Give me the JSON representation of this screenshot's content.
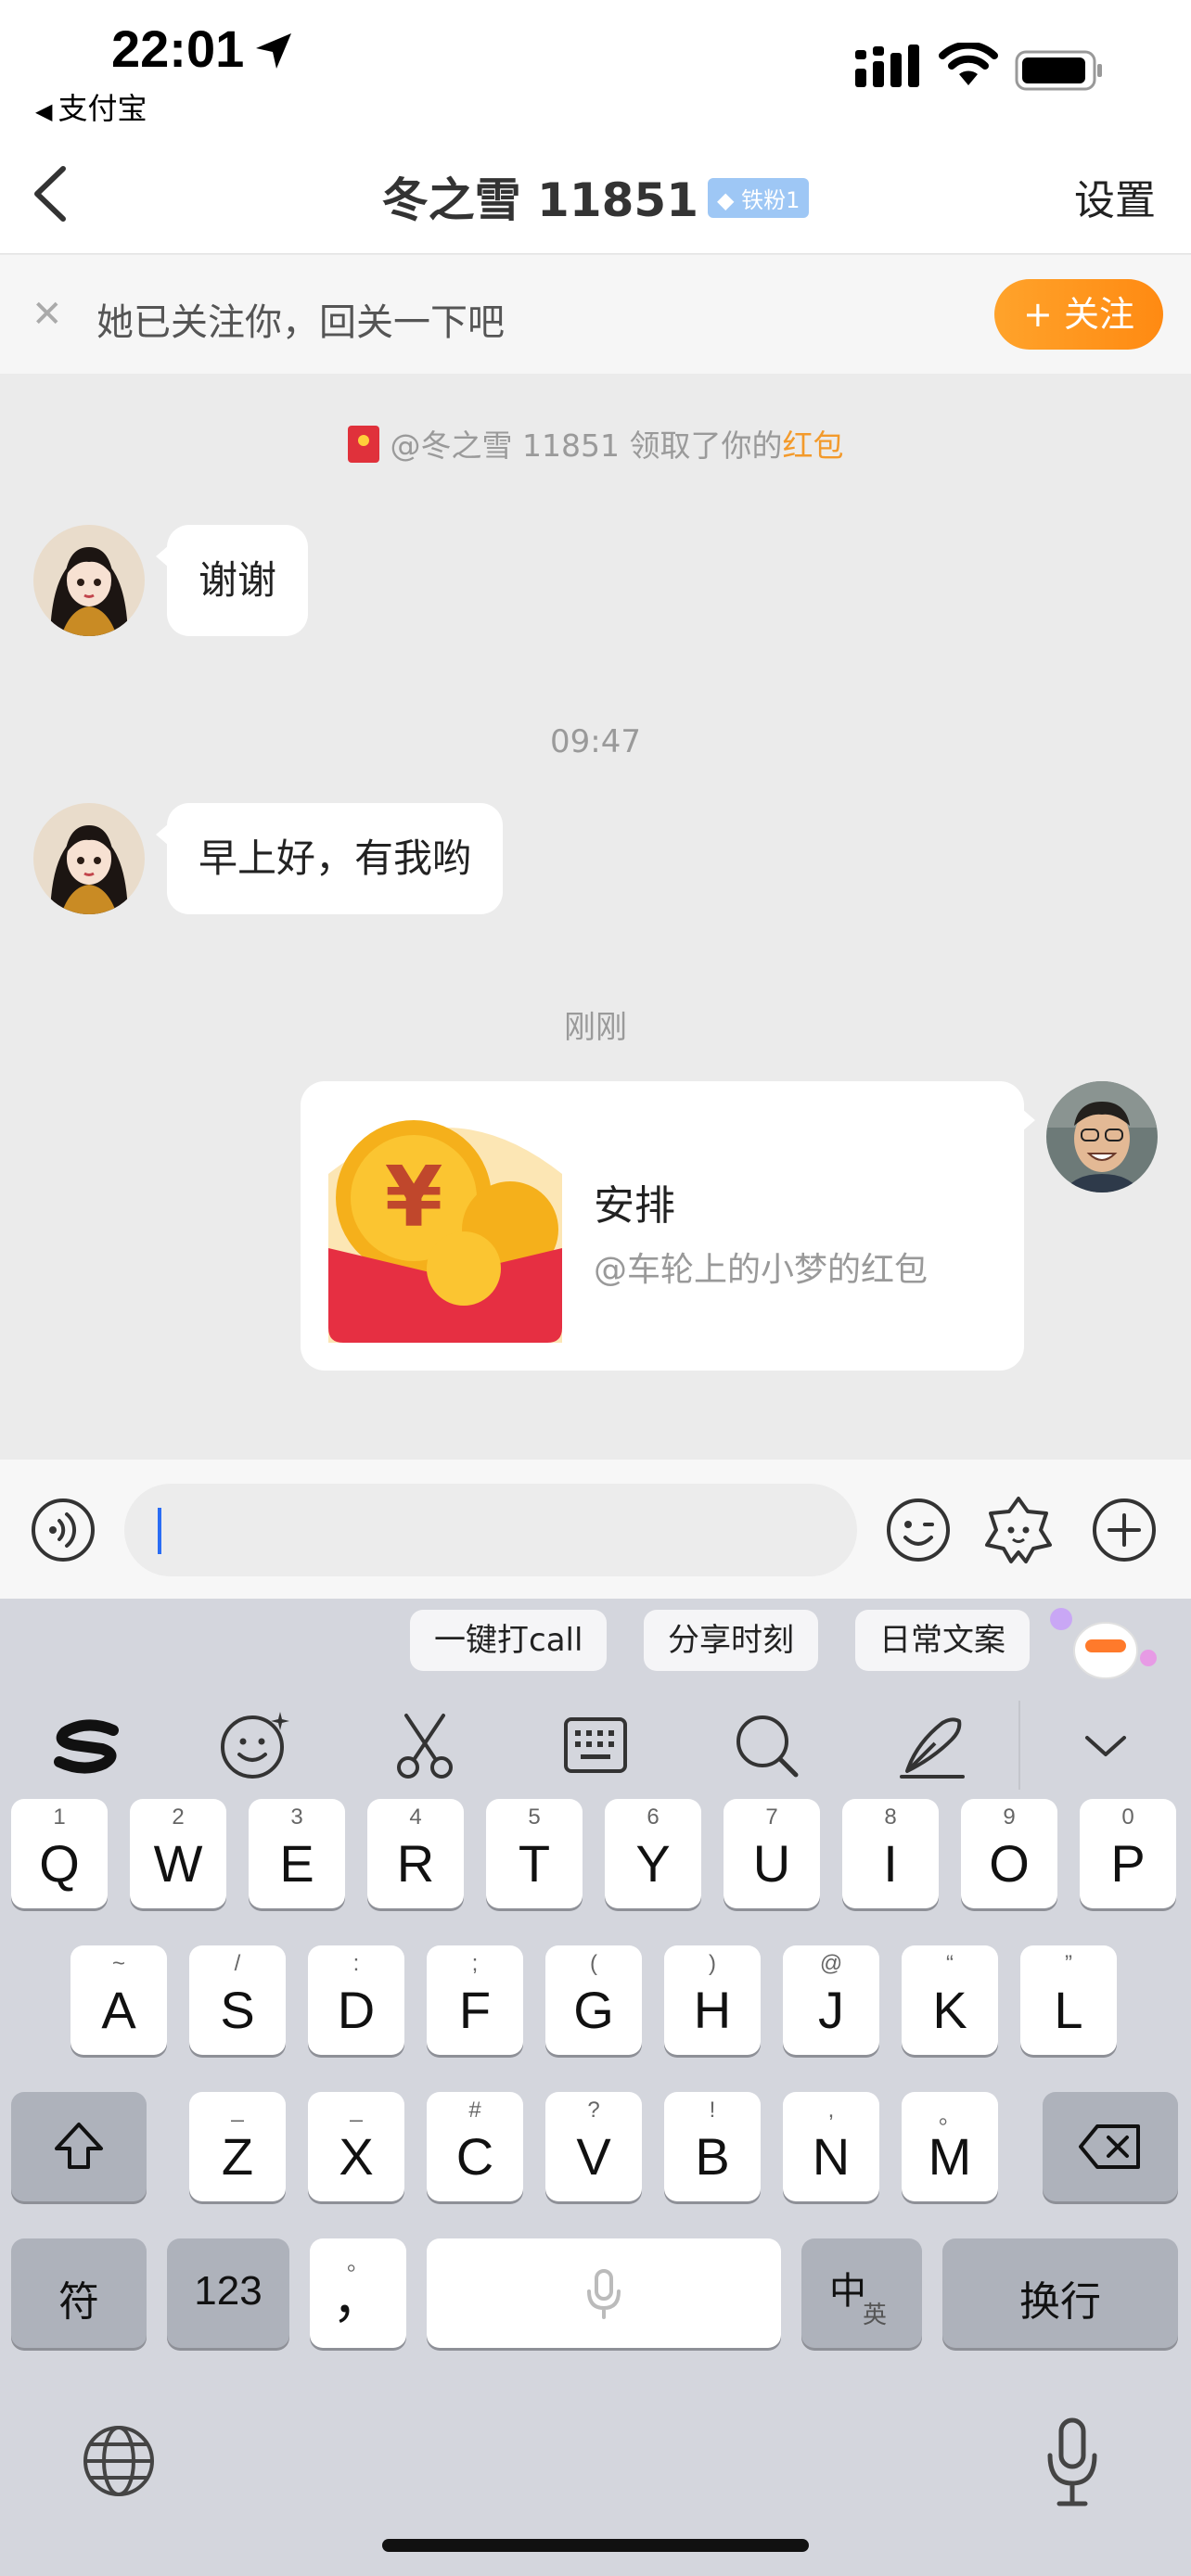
{
  "status_bar": {
    "time": "22:01",
    "back_app": "支付宝"
  },
  "nav": {
    "title": "冬之雪 11851",
    "fan_badge": "铁粉1",
    "settings_label": "设置"
  },
  "follow_banner": {
    "text": "她已关注你，回关一下吧",
    "follow_button": "+ 关注"
  },
  "chat": {
    "system_notice": {
      "prefix": "@冬之雪 11851 领取了你的",
      "highlight": "红包"
    },
    "messages": [
      {
        "sender": "other",
        "text": "谢谢"
      },
      {
        "timestamp": "09:47"
      },
      {
        "sender": "other",
        "text": "早上好，有我哟"
      },
      {
        "timestamp": "刚刚"
      },
      {
        "sender": "me",
        "type": "red_packet",
        "title": "安排",
        "subtitle": "@车轮上的小梦的红包"
      }
    ]
  },
  "input_bar": {
    "value": "",
    "icons": [
      "voice-icon",
      "emoji-icon",
      "sticker-icon",
      "plus-icon"
    ]
  },
  "keyboard": {
    "suggestions": [
      "一键打call",
      "分享时刻",
      "日常文案"
    ],
    "toolbar": [
      "logo-icon",
      "emoji-icon",
      "scissors-icon",
      "keyboard-icon",
      "search-icon",
      "pen-icon",
      "chevron-down-icon"
    ],
    "row1": [
      {
        "key": "Q",
        "hint": "1"
      },
      {
        "key": "W",
        "hint": "2"
      },
      {
        "key": "E",
        "hint": "3"
      },
      {
        "key": "R",
        "hint": "4"
      },
      {
        "key": "T",
        "hint": "5"
      },
      {
        "key": "Y",
        "hint": "6"
      },
      {
        "key": "U",
        "hint": "7"
      },
      {
        "key": "I",
        "hint": "8"
      },
      {
        "key": "O",
        "hint": "9"
      },
      {
        "key": "P",
        "hint": "0"
      }
    ],
    "row2": [
      {
        "key": "A",
        "hint": "~"
      },
      {
        "key": "S",
        "hint": "/"
      },
      {
        "key": "D",
        "hint": ":"
      },
      {
        "key": "F",
        "hint": ";"
      },
      {
        "key": "G",
        "hint": "("
      },
      {
        "key": "H",
        "hint": ")"
      },
      {
        "key": "J",
        "hint": "@"
      },
      {
        "key": "K",
        "hint": "“"
      },
      {
        "key": "L",
        "hint": "”"
      }
    ],
    "row3": [
      {
        "key": "Z",
        "hint": "_"
      },
      {
        "key": "X",
        "hint": "_"
      },
      {
        "key": "C",
        "hint": "#"
      },
      {
        "key": "V",
        "hint": "?"
      },
      {
        "key": "B",
        "hint": "!"
      },
      {
        "key": "N",
        "hint": ","
      },
      {
        "key": "M",
        "hint": "。"
      }
    ],
    "symbol_key": "符",
    "number_key": "123",
    "punct_key": "，",
    "punct_hint": "。",
    "lang_key_main": "中",
    "lang_key_sub": "英",
    "return_key": "换行"
  },
  "colors": {
    "accent": "#ff8a12",
    "link": "#f39a2b",
    "caret": "#2a6df4",
    "red_packet": "#e0313b"
  }
}
